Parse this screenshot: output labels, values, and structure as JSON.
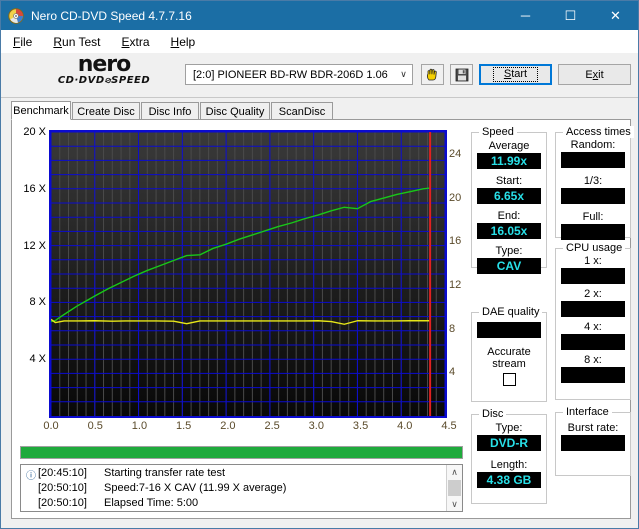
{
  "window": {
    "title": "Nero CD-DVD Speed 4.7.7.16",
    "icon": "nero-disc-icon",
    "minimize": "─",
    "maximize": "☐",
    "close": "✕"
  },
  "menu": {
    "items": [
      {
        "label": "File",
        "accel": "F"
      },
      {
        "label": "Run Test",
        "accel": "R"
      },
      {
        "label": "Extra",
        "accel": "E"
      },
      {
        "label": "Help",
        "accel": "H"
      }
    ]
  },
  "logo": {
    "brand": "nero",
    "sub_left": "CD·DVD",
    "sub_slash": "⌀",
    "sub_right": "SPEED"
  },
  "toolbar": {
    "drive": "[2:0]  PIONEER BD-RW  BDR-206D 1.06",
    "drive_arrow": "∨",
    "hand_icon": "hand-tool-icon",
    "save_icon": "floppy-save-icon",
    "start_label": "Start",
    "start_accel": "S",
    "exit_label": "Exit",
    "exit_accel": "x"
  },
  "tabs": [
    {
      "label": "Benchmark",
      "active": true
    },
    {
      "label": "Create Disc",
      "active": false
    },
    {
      "label": "Disc Info",
      "active": false
    },
    {
      "label": "Disc Quality",
      "active": false
    },
    {
      "label": "ScanDisc",
      "active": false
    }
  ],
  "progress": {
    "percent": 100
  },
  "log": {
    "rows": [
      {
        "icon": "ⓘ",
        "time": "[20:45:10]",
        "message": "Starting transfer rate test"
      },
      {
        "icon": "",
        "time": "[20:50:10]",
        "message": "Speed:7-16 X CAV (11.99 X average)"
      },
      {
        "icon": "",
        "time": "[20:50:10]",
        "message": "Elapsed Time:  5:00"
      }
    ],
    "scroll_up": "∧",
    "scroll_down": "∨"
  },
  "panels": {
    "speed": {
      "legend": "Speed",
      "fields": [
        {
          "label": "Average",
          "value": "11.99x"
        },
        {
          "label": "Start:",
          "value": "6.65x"
        },
        {
          "label": "End:",
          "value": "16.05x"
        },
        {
          "label": "Type:",
          "value": "CAV"
        }
      ]
    },
    "dae_quality": {
      "legend": "DAE quality",
      "value": "",
      "checkbox_label_1": "Accurate",
      "checkbox_label_2": "stream",
      "checked": false
    },
    "disc": {
      "legend": "Disc",
      "fields": [
        {
          "label": "Type:",
          "value": "DVD-R"
        },
        {
          "label": "Length:",
          "value": "4.38 GB"
        }
      ]
    },
    "access_times": {
      "legend": "Access times",
      "fields": [
        {
          "label": "Random:",
          "value": ""
        },
        {
          "label": "1/3:",
          "value": ""
        },
        {
          "label": "Full:",
          "value": ""
        }
      ]
    },
    "cpu_usage": {
      "legend": "CPU usage",
      "fields": [
        {
          "label": "1 x:",
          "value": ""
        },
        {
          "label": "2 x:",
          "value": ""
        },
        {
          "label": "4 x:",
          "value": ""
        },
        {
          "label": "8 x:",
          "value": ""
        }
      ]
    },
    "interface": {
      "legend": "Interface",
      "fields": [
        {
          "label": "Burst rate:",
          "value": ""
        }
      ]
    }
  },
  "chart_data": {
    "type": "line",
    "title": "",
    "xlabel": "",
    "ylabel": "",
    "background": "#171717",
    "grid": true,
    "grid_color": "#0b0bd0",
    "grid_minor_color": "#3a3a3a",
    "xlim": [
      0.0,
      4.5
    ],
    "xticks": [
      "0.0",
      "0.5",
      "1.0",
      "1.5",
      "2.0",
      "2.5",
      "3.0",
      "3.5",
      "4.0",
      "4.5"
    ],
    "xtick_values": [
      0.0,
      0.5,
      1.0,
      1.5,
      2.0,
      2.5,
      3.0,
      3.5,
      4.0,
      4.5
    ],
    "ylim_left": [
      0,
      20
    ],
    "yticks_left": [
      "4 X",
      "8 X",
      "12 X",
      "16 X",
      "20 X"
    ],
    "ytick_values_left": [
      4,
      8,
      12,
      16,
      20
    ],
    "ylim_right": [
      0,
      26
    ],
    "yticks_right": [
      "4",
      "8",
      "12",
      "16",
      "20",
      "24"
    ],
    "ytick_values_right": [
      4,
      8,
      12,
      16,
      20,
      24
    ],
    "series": [
      {
        "name": "Transfer rate",
        "color": "#18c818",
        "axis": "left",
        "x": [
          0.0,
          0.05,
          0.1,
          0.2,
          0.3,
          0.4,
          0.5,
          0.65,
          0.8,
          0.95,
          1.1,
          1.25,
          1.4,
          1.55,
          1.7,
          1.85,
          2.0,
          2.15,
          2.3,
          2.45,
          2.6,
          2.75,
          2.9,
          3.05,
          3.2,
          3.35,
          3.5,
          3.65,
          3.8,
          3.95,
          4.1,
          4.25,
          4.33
        ],
        "values": [
          6.65,
          6.72,
          6.95,
          7.35,
          7.75,
          8.1,
          8.45,
          8.95,
          9.4,
          9.85,
          10.25,
          10.6,
          10.95,
          11.3,
          11.35,
          11.8,
          12.1,
          12.45,
          12.75,
          13.05,
          13.35,
          13.6,
          13.9,
          14.15,
          14.45,
          14.7,
          14.6,
          15.1,
          15.35,
          15.6,
          15.8,
          16.0,
          16.05
        ]
      },
      {
        "name": "Disc rotation speed",
        "color": "#e8e818",
        "axis": "right",
        "x": [
          0.0,
          0.05,
          0.15,
          0.3,
          0.5,
          0.7,
          0.85,
          1.0,
          1.2,
          1.4,
          1.55,
          1.7,
          1.9,
          2.1,
          2.3,
          2.5,
          2.7,
          2.9,
          3.05,
          3.2,
          3.35,
          3.5,
          3.7,
          3.9,
          4.1,
          4.25,
          4.33
        ],
        "values": [
          8.85,
          8.55,
          8.7,
          8.7,
          8.72,
          8.68,
          8.7,
          8.7,
          8.7,
          8.68,
          8.45,
          8.7,
          8.7,
          8.7,
          8.7,
          8.7,
          8.7,
          8.7,
          8.72,
          8.65,
          8.4,
          8.72,
          8.7,
          8.7,
          8.72,
          8.72,
          8.72
        ]
      }
    ],
    "annotations": [
      {
        "type": "vline",
        "x": 4.33,
        "color": "#e02020",
        "name": "end-of-disc-marker"
      }
    ]
  }
}
